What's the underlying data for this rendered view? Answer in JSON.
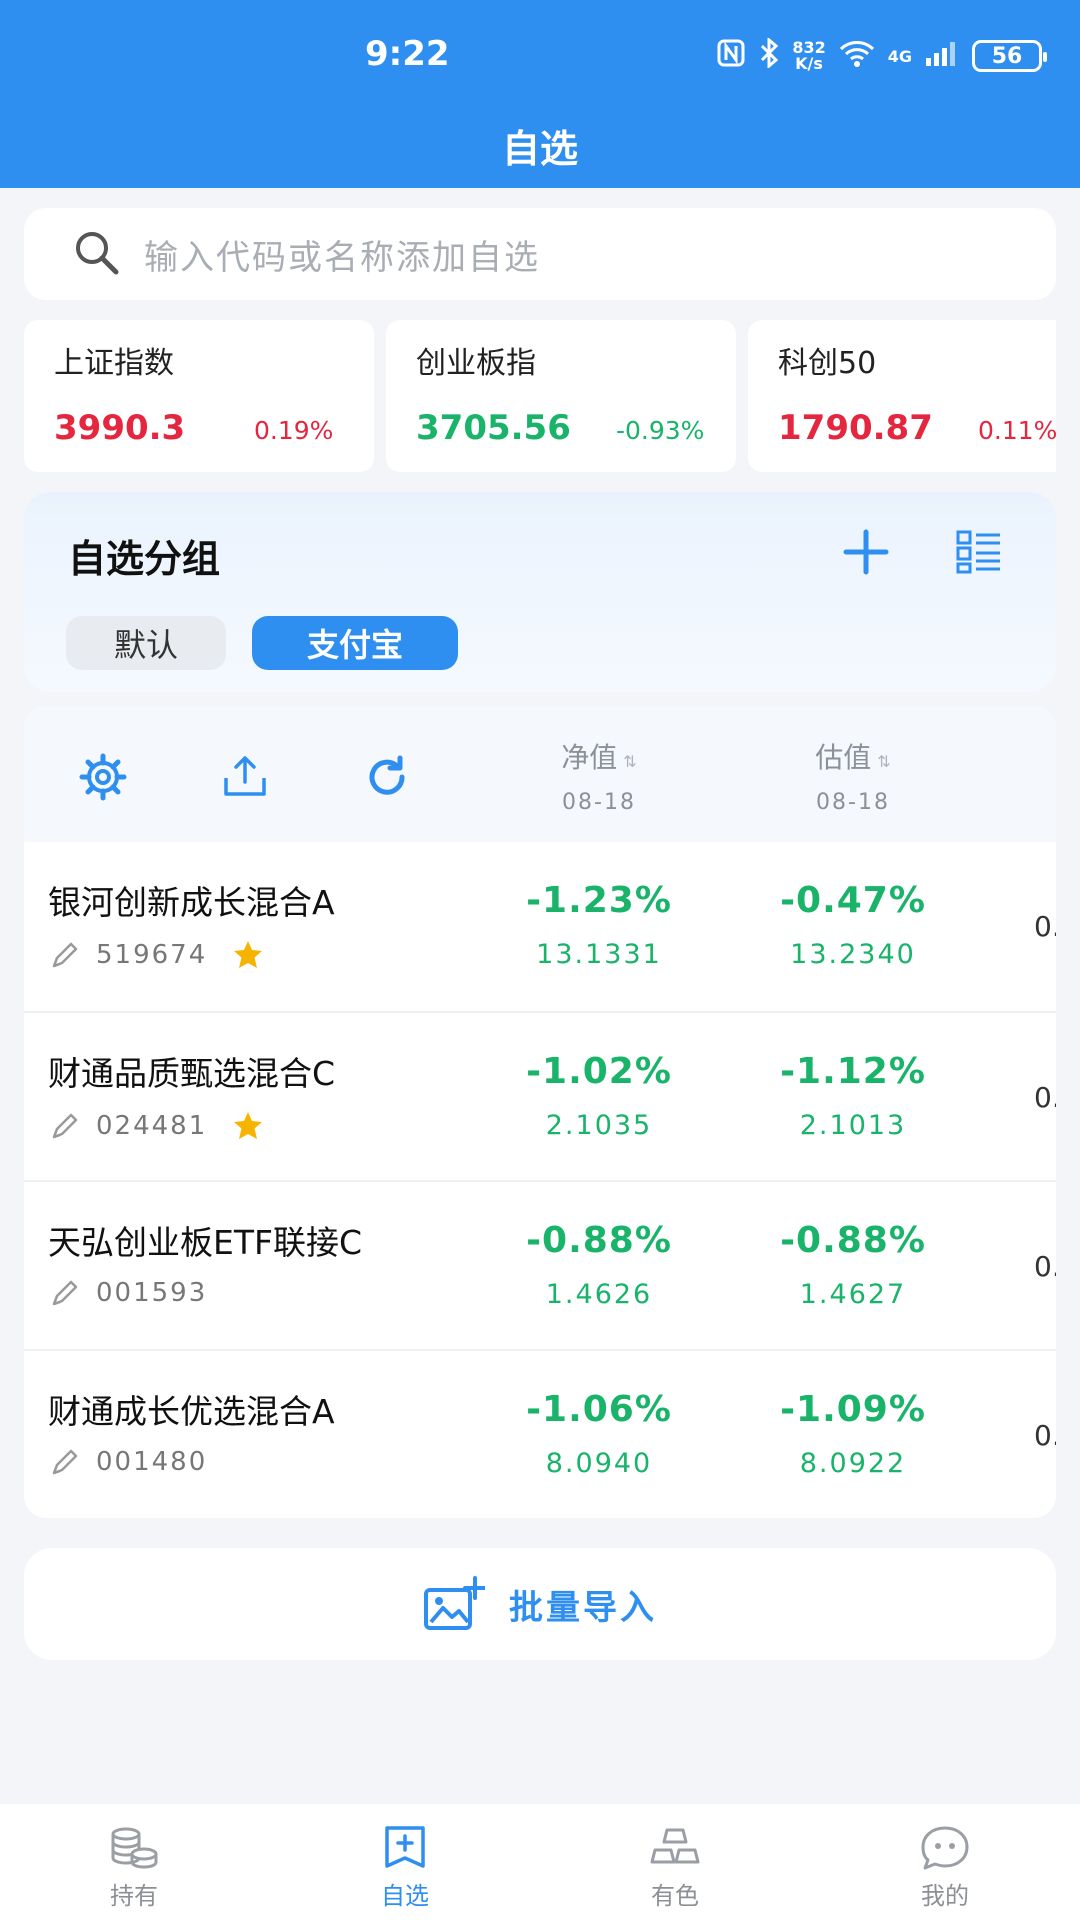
{
  "status_bar": {
    "time": "9:22",
    "speed_top": "832",
    "speed_bottom": "K/s",
    "network": "4G",
    "battery": "56"
  },
  "header": {
    "title": "自选"
  },
  "search": {
    "placeholder": "输入代码或名称添加自选"
  },
  "indices": [
    {
      "name": "上证指数",
      "value": "3990.3",
      "change": "0.19%",
      "trend": "up"
    },
    {
      "name": "创业板指",
      "value": "3705.56",
      "change": "-0.93%",
      "trend": "down"
    },
    {
      "name": "科创50",
      "value": "1790.87",
      "change": "0.11%",
      "trend": "up"
    }
  ],
  "groups": {
    "title": "自选分组",
    "chips": [
      "默认",
      "支付宝"
    ],
    "selected": "支付宝"
  },
  "fund_table": {
    "columns": [
      {
        "title": "净值",
        "date": "08-18"
      },
      {
        "title": "估值",
        "date": "08-18"
      }
    ],
    "rows": [
      {
        "name": "银河创新成长混合A",
        "code": "519674",
        "starred": true,
        "nav_change": "-1.23%",
        "nav": "13.1331",
        "est_change": "-0.47%",
        "est": "13.2340",
        "cut": "0."
      },
      {
        "name": "财通品质甄选混合C",
        "code": "024481",
        "starred": true,
        "nav_change": "-1.02%",
        "nav": "2.1035",
        "est_change": "-1.12%",
        "est": "2.1013",
        "cut": "0."
      },
      {
        "name": "天弘创业板ETF联接C",
        "code": "001593",
        "starred": false,
        "nav_change": "-0.88%",
        "nav": "1.4626",
        "est_change": "-0.88%",
        "est": "1.4627",
        "cut": "0."
      },
      {
        "name": "财通成长优选混合A",
        "code": "001480",
        "starred": false,
        "nav_change": "-1.06%",
        "nav": "8.0940",
        "est_change": "-1.09%",
        "est": "8.0922",
        "cut": "0."
      }
    ]
  },
  "import_button": {
    "label": "批量导入"
  },
  "tabbar": {
    "items": [
      {
        "label": "持有",
        "icon": "coins-icon"
      },
      {
        "label": "自选",
        "icon": "add-bookmark-icon",
        "active": true
      },
      {
        "label": "有色",
        "icon": "gold-bars-icon"
      },
      {
        "label": "我的",
        "icon": "chat-face-icon"
      }
    ]
  },
  "colors": {
    "primary": "#2f8ff0",
    "up": "#e4263f",
    "down": "#19b36a",
    "star": "#f6b400"
  }
}
